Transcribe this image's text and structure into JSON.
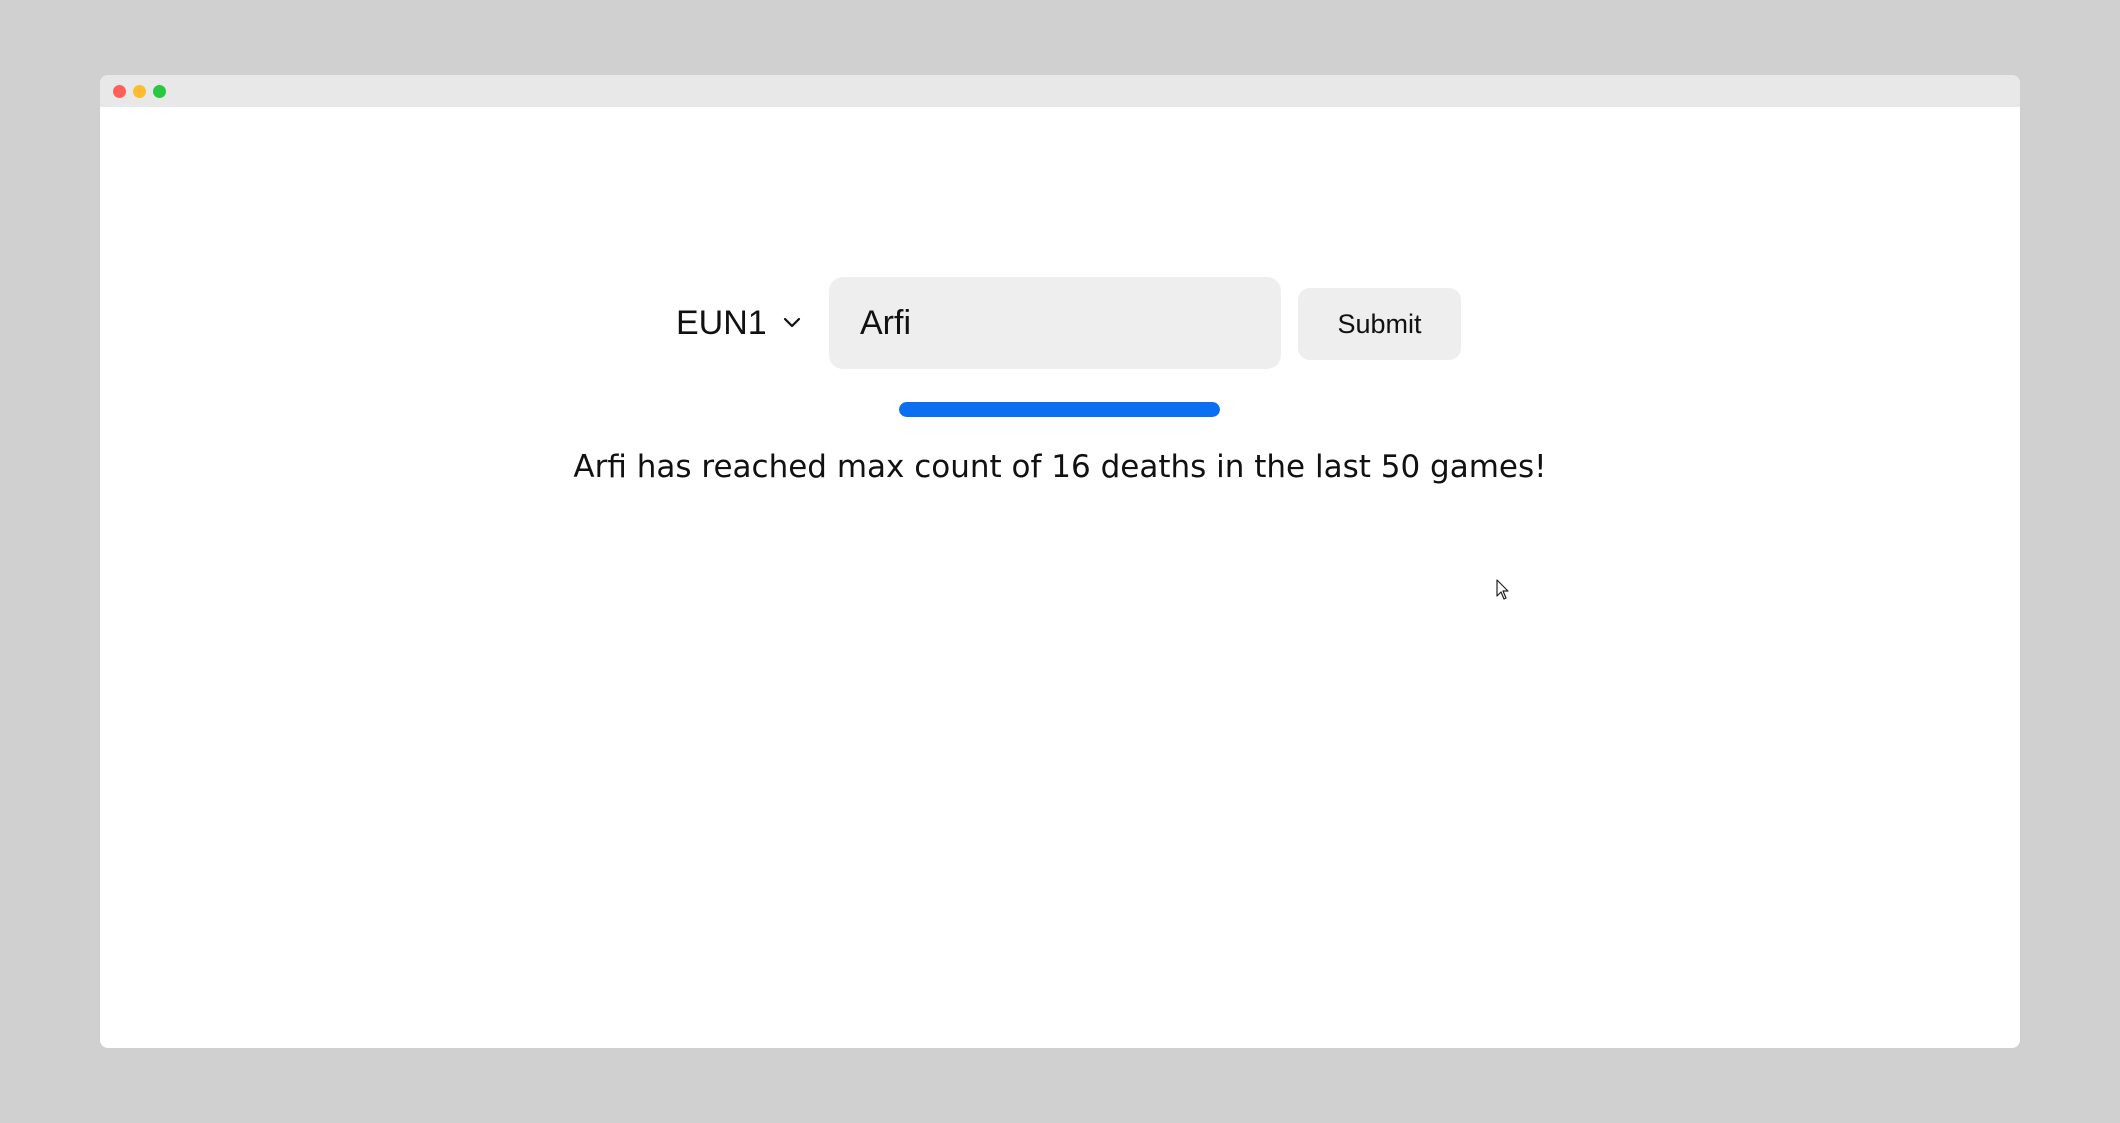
{
  "window": {
    "controls": [
      "close",
      "minimize",
      "maximize"
    ]
  },
  "form": {
    "region": {
      "selected": "EUN1",
      "icon": "chevron-down-icon"
    },
    "summoner_input": {
      "value": "Arfi"
    },
    "submit_label": "Submit"
  },
  "progress": {
    "fraction": 1.0,
    "color": "#0a6ff0"
  },
  "result": {
    "message": "Arfi has reached max count of 16 deaths in the last 50 games!"
  },
  "colors": {
    "accent": "#0a6ff0",
    "close": "#ff5f57",
    "minimize": "#febc2e",
    "maximize": "#28c840"
  }
}
